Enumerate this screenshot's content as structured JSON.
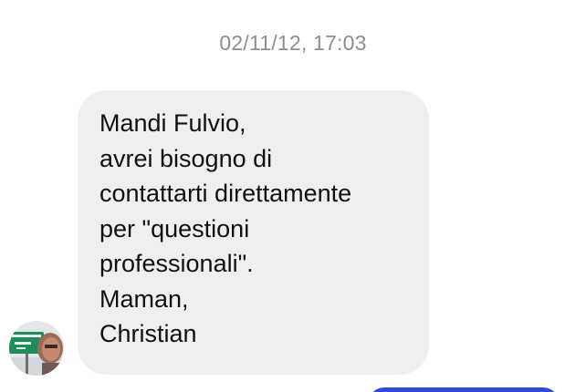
{
  "conversation": {
    "timestamp": "02/11/12, 17:03",
    "incoming_message": {
      "lines": [
        "Mandi Fulvio,",
        "avrei bisogno di",
        "contattarti direttamente",
        "per \"questioni",
        "professionali\".",
        "Maman,",
        "Christian"
      ]
    },
    "sender_avatar_icon": "contact-photo-icon"
  },
  "colors": {
    "incoming_bubble": "#efeff0",
    "timestamp_text": "#8e8e93",
    "outgoing_bubble": "#2f49d8"
  }
}
